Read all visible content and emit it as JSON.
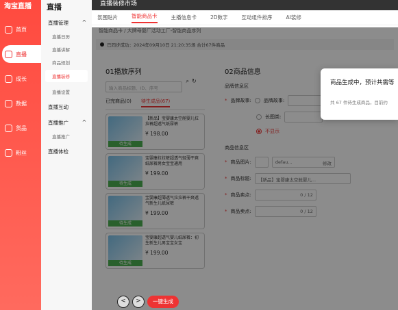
{
  "leftnav": {
    "brand": "淘宝直播",
    "items": [
      {
        "label": "首页",
        "icon": "home-icon"
      },
      {
        "label": "直播",
        "icon": "live-icon"
      },
      {
        "label": "成长",
        "icon": "growth-icon"
      },
      {
        "label": "数据",
        "icon": "data-icon"
      },
      {
        "label": "货品",
        "icon": "goods-icon"
      },
      {
        "label": "粉丝",
        "icon": "fans-icon"
      }
    ]
  },
  "subnav": {
    "title": "直播",
    "groups": [
      {
        "label": "直播管理",
        "items": [
          "直播日历",
          "直播讲解",
          "商品规划",
          "直播装修",
          "直播设置"
        ]
      },
      {
        "label": "直播互动",
        "items": []
      },
      {
        "label": "直播推广",
        "items": [
          "直播推广"
        ]
      },
      {
        "label": "直播体检",
        "items": []
      }
    ]
  },
  "main": {
    "topbar_title": "直播装修市场",
    "tabs": [
      "氛围贴片",
      "智能商品卡",
      "主播信息卡",
      "2D数字",
      "互动组件排序",
      "AI装修"
    ],
    "breadcrumb": "智能商品卡 / 大牌母婴厂活动工厂-智能商品序列",
    "notice": "已同步成功：2024年09月10日 21:20:35场 合计67件商品",
    "left_title": "01播放序列",
    "search_placeholder": "输入商品标题、ID、序号",
    "row_tabs": [
      "已完商品(0)",
      "待生成品(67)"
    ],
    "cards": [
      {
        "title": "【新品】宝婴康太空舱婴儿拉拉裤超透气纸尿裤",
        "status": "待生成",
        "price": "¥ 198.00"
      },
      {
        "title": "宝婴康拉拉裤超透气轻薄干爽纸尿裤男女宝宝通用",
        "status": "待生成",
        "price": "¥ 199.00"
      },
      {
        "title": "宝婴康超薄透气拉拉裤干爽透气新生儿纸尿裤",
        "status": "待生成",
        "price": "¥ 199.00"
      },
      {
        "title": "宝婴康超透气婴儿纸尿裤：初生新生儿男宝宝女宝",
        "status": "待生成",
        "price": "¥ 199.00"
      }
    ],
    "right_title": "02商品信息",
    "section1": "品牌信息区",
    "brand_story_label": "品牌故事:",
    "brand_story_opt": "品牌故事:",
    "long_img_opt": "长图类:",
    "no_show_opt": "不显示",
    "section2": "商品信息区",
    "img_label": "商品图片:",
    "img_value": "defau...",
    "modify_label": "修改",
    "title_label": "商品标题:",
    "title_value": "【新品】宝婴康太空舱婴儿...",
    "sell1_label": "商品卖点:",
    "sell1_count": "0 / 12",
    "sell2_label": "商品卖点:",
    "sell2_count": "0 / 12"
  },
  "toast": {
    "line1": "商品生成中，预计共需等",
    "line2": "共 67 件待生成商品，目前约"
  },
  "bottom": {
    "prev": "<",
    "next": ">",
    "generate": "一键生成"
  }
}
